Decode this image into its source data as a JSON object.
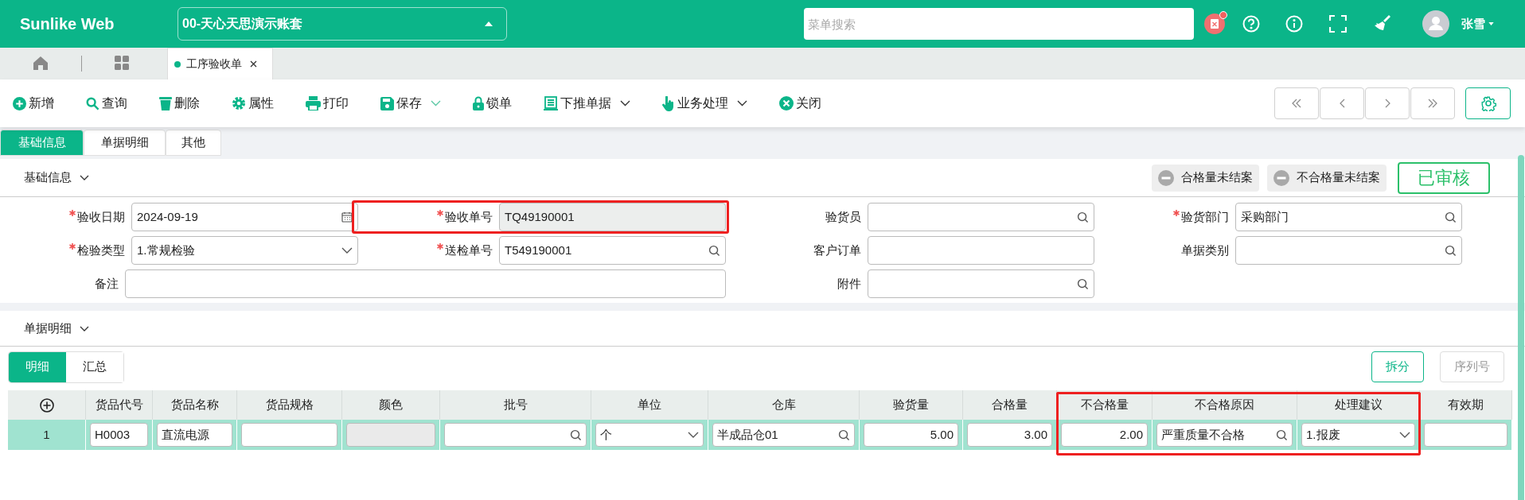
{
  "header": {
    "logo": "Sunlike Web",
    "account": "00-天心天思演示账套",
    "search": {
      "placeholder": "菜单搜索"
    },
    "notification": true,
    "user": "张雪"
  },
  "page_tabs": [
    {
      "label": "工序验收单",
      "selected": true
    }
  ],
  "toolbar": [
    {
      "label": "新增",
      "dropdown": false
    },
    {
      "label": "查询",
      "dropdown": false
    },
    {
      "label": "删除",
      "dropdown": false
    },
    {
      "label": "属性",
      "dropdown": false
    },
    {
      "label": "打印",
      "dropdown": false
    },
    {
      "label": "保存",
      "dropdown": true
    },
    {
      "label": "锁单",
      "dropdown": false
    },
    {
      "label": "下推单据",
      "dropdown": true
    },
    {
      "label": "业务处理",
      "dropdown": true
    },
    {
      "label": "关闭",
      "dropdown": false
    }
  ],
  "form_tabs": [
    {
      "label": "基础信息",
      "selected": true
    },
    {
      "label": "单据明细",
      "selected": false
    },
    {
      "label": "其他",
      "selected": false
    }
  ],
  "basic_section": {
    "title": "基础信息",
    "expanded": true,
    "status_chips": [
      "合格量未结案",
      "不合格量未结案"
    ],
    "stamp": "已审核"
  },
  "fields": [
    {
      "label": "验收日期",
      "required": true,
      "kind": "date",
      "value": "2024-09-19",
      "wide": false,
      "readonly": false,
      "highlighted": false
    },
    {
      "label": "验收单号",
      "required": true,
      "kind": "text",
      "value": "TQ49190001",
      "wide": false,
      "readonly": true,
      "highlighted": true
    },
    {
      "label": "验货员",
      "required": false,
      "kind": "lookup",
      "wide": false,
      "readonly": false,
      "highlighted": false
    },
    {
      "label": "验货部门",
      "required": true,
      "kind": "lookup",
      "value": "采购部门",
      "wide": false,
      "readonly": false,
      "highlighted": false
    },
    {
      "label": "检验类型",
      "required": true,
      "kind": "select",
      "value": "1.常规检验",
      "wide": false,
      "readonly": false,
      "highlighted": false
    },
    {
      "label": "送检单号",
      "required": true,
      "kind": "lookup",
      "value": "T549190001",
      "wide": false,
      "readonly": false,
      "highlighted": false
    },
    {
      "label": "客户订单",
      "required": false,
      "kind": "text",
      "wide": false,
      "readonly": false,
      "highlighted": false
    },
    {
      "label": "单据类别",
      "required": false,
      "kind": "lookup",
      "wide": false,
      "readonly": false,
      "highlighted": false
    },
    {
      "label": "备注",
      "required": false,
      "kind": "text",
      "wide": true,
      "readonly": false,
      "highlighted": false
    },
    {
      "label": "附件",
      "required": false,
      "kind": "lookup",
      "wide": false,
      "readonly": false,
      "highlighted": false
    }
  ],
  "detail_section": {
    "title": "单据明细",
    "expanded": true
  },
  "detail_tabs": [
    {
      "label": "明细",
      "selected": true
    },
    {
      "label": "汇总",
      "selected": false
    }
  ],
  "detail_buttons": [
    {
      "label": "拆分",
      "disabled": false
    },
    {
      "label": "序列号",
      "disabled": true
    }
  ],
  "table": {
    "columns": [
      {
        "kind": "add",
        "highlighted": false
      },
      {
        "label": "货品代号",
        "highlighted": false
      },
      {
        "label": "货品名称",
        "highlighted": false
      },
      {
        "label": "货品规格",
        "highlighted": false
      },
      {
        "label": "颜色",
        "highlighted": false
      },
      {
        "label": "批号",
        "highlighted": false
      },
      {
        "label": "单位",
        "highlighted": false
      },
      {
        "label": "仓库",
        "highlighted": false
      },
      {
        "label": "验货量",
        "highlighted": false
      },
      {
        "label": "合格量",
        "highlighted": false
      },
      {
        "label": "不合格量",
        "highlighted": true
      },
      {
        "label": "不合格原因",
        "highlighted": true
      },
      {
        "label": "处理建议",
        "highlighted": true
      },
      {
        "label": "有效期",
        "highlighted": false
      }
    ],
    "rows": [
      {
        "selected": true,
        "cells": [
          {
            "kind": "index",
            "value": "1"
          },
          {
            "kind": "text",
            "value": "H0003"
          },
          {
            "kind": "text",
            "value": "直流电源"
          },
          {
            "kind": "text"
          },
          {
            "kind": "disabled"
          },
          {
            "kind": "lookup"
          },
          {
            "kind": "select",
            "value": "个"
          },
          {
            "kind": "lookup",
            "value": "半成品仓01"
          },
          {
            "kind": "number",
            "value": "5.00"
          },
          {
            "kind": "number",
            "value": "3.00"
          },
          {
            "kind": "number",
            "value": "2.00"
          },
          {
            "kind": "lookup",
            "value": "严重质量不合格"
          },
          {
            "kind": "select",
            "value": "1.报废"
          },
          {
            "kind": "text"
          }
        ]
      }
    ]
  }
}
